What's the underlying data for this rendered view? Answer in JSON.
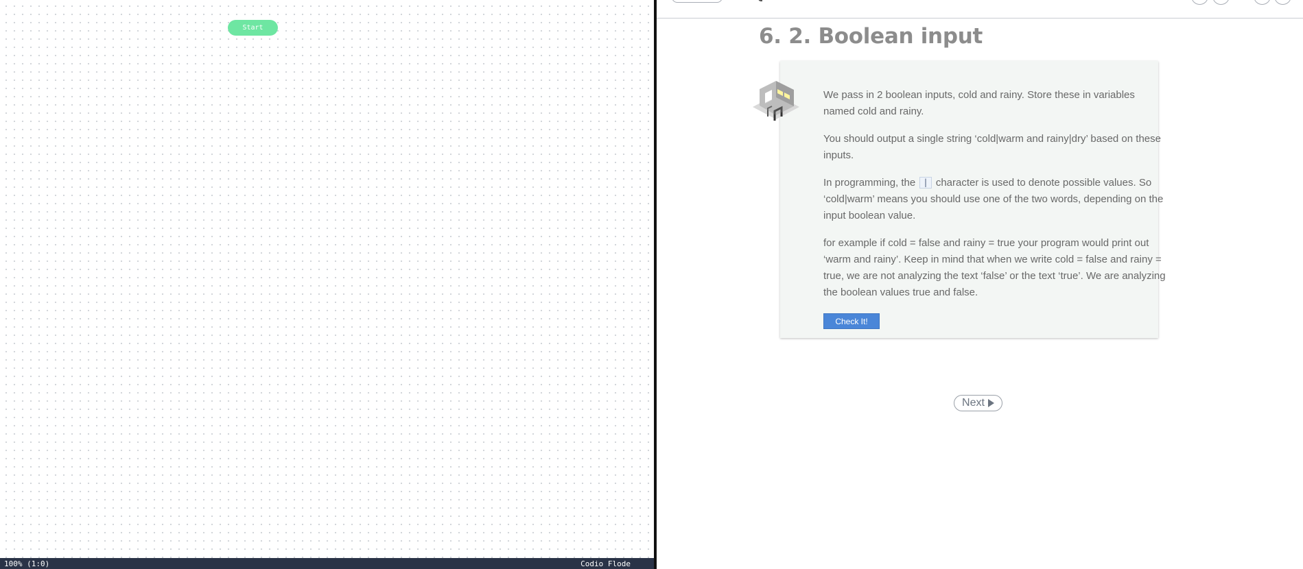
{
  "canvas": {
    "start_node_label": "Start"
  },
  "status_bar": {
    "zoom": "100% (1:0)",
    "app_name": "Codio Flode"
  },
  "guide": {
    "title": "6. 2. Boolean input",
    "paragraphs": {
      "p1": "We pass in 2 boolean inputs, cold and rainy. Store these in variables named cold and rainy.",
      "p2": "You should output a single string ‘cold|warm and rainy|dry’ based on these inputs.",
      "p3_before": "In programming, the",
      "p3_code": "|",
      "p3_after": "character is used to denote possible values. So ‘cold|warm’ means you should use one of the two words, depending on the input boolean value.",
      "p4": "for example if cold = false and rainy = true your program would print out ‘warm and rainy’. Keep in mind that when we write cold = false and rainy = true, we are not analyzing the text ‘false’ or the text ‘true’. We are analyzing the boolean values true and false."
    },
    "check_button_label": "Check It!",
    "next_button_label": "Next"
  },
  "icons": {
    "card_art": "isometric-building-icon",
    "next": "play-icon"
  },
  "colors": {
    "start_node": "#6ee6a2",
    "status_bar": "#2a3347",
    "check_button": "#4a86d8",
    "card_background": "#f3f6f4",
    "title": "#8c8c8c"
  }
}
